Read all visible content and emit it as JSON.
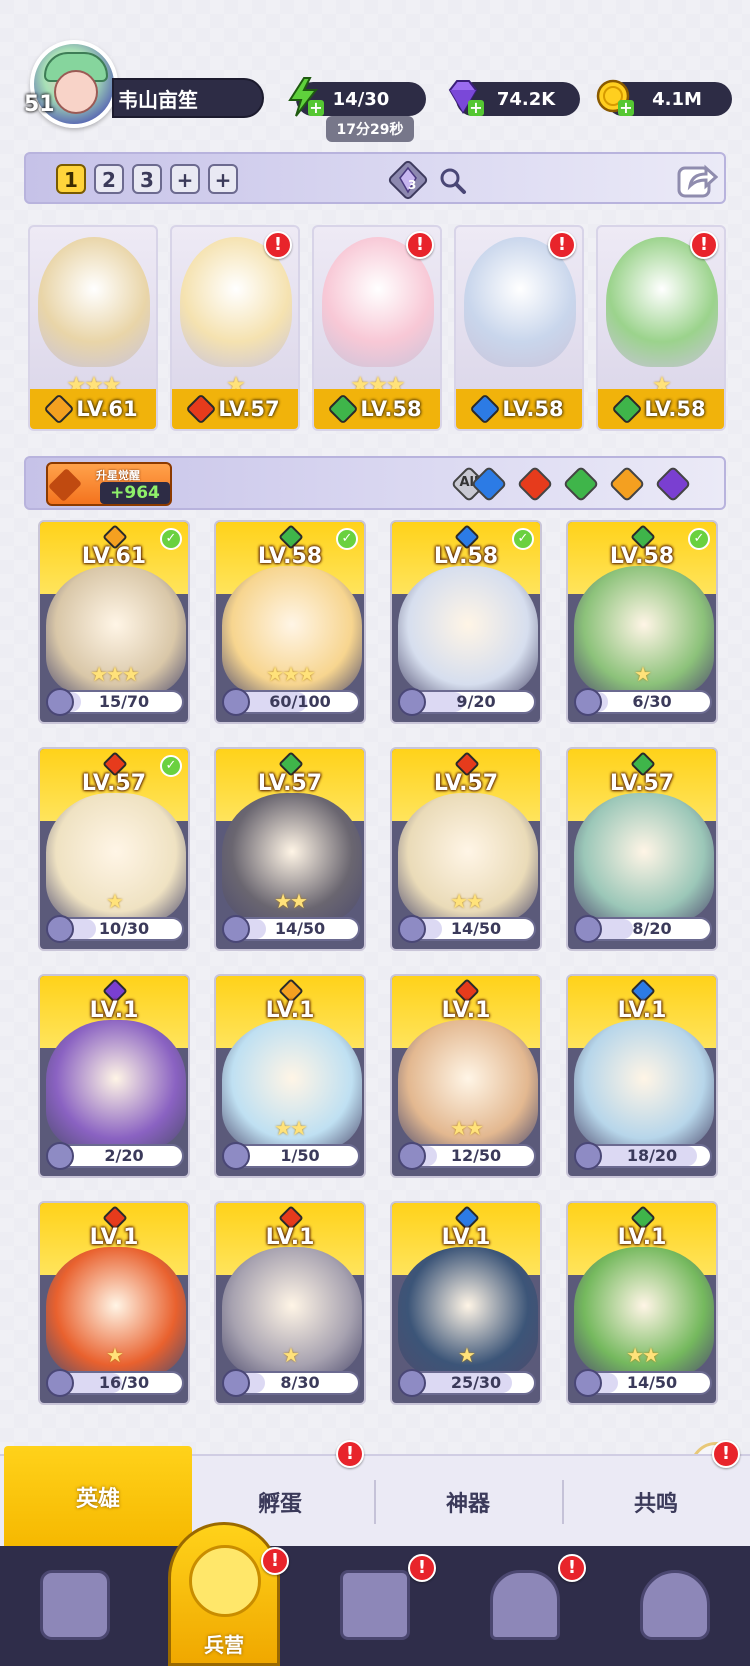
{
  "player": {
    "level": "51",
    "name": "韦山亩笙"
  },
  "resources": {
    "energy": "14/30",
    "energy_timer": "17分29秒",
    "gems": "74.2K",
    "gold": "4.1M",
    "plus_symbol": "+"
  },
  "team": {
    "tabs": [
      "1",
      "2",
      "3",
      "+",
      "+"
    ],
    "active_tab": "1",
    "badge_count": "3"
  },
  "team_heroes": [
    {
      "level": "LV.61",
      "stars": "★★★",
      "element": "light",
      "color": "#f4a020",
      "art": "#e9d5a8",
      "alert": false
    },
    {
      "level": "LV.57",
      "stars": "★",
      "element": "fire",
      "color": "#e63b1c",
      "art": "#f5e2b0",
      "alert": true
    },
    {
      "level": "LV.58",
      "stars": "★★★",
      "element": "nature",
      "color": "#3fb54a",
      "art": "#f8c8d6",
      "alert": true
    },
    {
      "level": "LV.58",
      "stars": "",
      "element": "water",
      "color": "#2c7be5",
      "art": "#c9d6ec",
      "alert": true
    },
    {
      "level": "LV.58",
      "stars": "★",
      "element": "nature",
      "color": "#3fb54a",
      "art": "#9bd38c",
      "alert": true
    }
  ],
  "filter": {
    "awaken_label": "升星觉醒",
    "awaken_count": "+964",
    "all_label": "All",
    "elements": [
      {
        "name": "water",
        "color": "#2c7be5"
      },
      {
        "name": "fire",
        "color": "#e63b1c"
      },
      {
        "name": "nature",
        "color": "#3fb54a"
      },
      {
        "name": "light",
        "color": "#f4a020"
      },
      {
        "name": "dark",
        "color": "#7a3fd1"
      }
    ]
  },
  "heroes": [
    {
      "level": "LV.61",
      "fragments": "15/70",
      "progress": 0.21,
      "element": "light",
      "color": "#f4a020",
      "art": "#d9c7a8",
      "check": true,
      "stars": "★★★"
    },
    {
      "level": "LV.58",
      "fragments": "60/100",
      "progress": 0.6,
      "element": "nature",
      "color": "#3fb54a",
      "art": "#f7d58f",
      "check": true,
      "stars": "★★★"
    },
    {
      "level": "LV.58",
      "fragments": "9/20",
      "progress": 0.45,
      "element": "water",
      "color": "#2c7be5",
      "art": "#d6deee",
      "check": true,
      "stars": ""
    },
    {
      "level": "LV.58",
      "fragments": "6/30",
      "progress": 0.2,
      "element": "nature",
      "color": "#3fb54a",
      "art": "#8cc27a",
      "check": true,
      "stars": "★"
    },
    {
      "level": "LV.57",
      "fragments": "10/30",
      "progress": 0.33,
      "element": "fire",
      "color": "#e63b1c",
      "art": "#efe2c2",
      "check": true,
      "stars": "★"
    },
    {
      "level": "LV.57",
      "fragments": "14/50",
      "progress": 0.28,
      "element": "nature",
      "color": "#3fb54a",
      "art": "#6a6670",
      "check": false,
      "stars": "★★"
    },
    {
      "level": "LV.57",
      "fragments": "14/50",
      "progress": 0.28,
      "element": "fire",
      "color": "#e63b1c",
      "art": "#eadbb8",
      "check": false,
      "stars": "★★"
    },
    {
      "level": "LV.57",
      "fragments": "8/20",
      "progress": 0.4,
      "element": "nature",
      "color": "#3fb54a",
      "art": "#9bc7b8",
      "check": false,
      "stars": ""
    },
    {
      "level": "LV.1",
      "fragments": "2/20",
      "progress": 0.1,
      "element": "dark",
      "color": "#7a3fd1",
      "art": "#8a62c2",
      "check": false,
      "stars": ""
    },
    {
      "level": "LV.1",
      "fragments": "1/50",
      "progress": 0.02,
      "element": "light",
      "color": "#f4a020",
      "art": "#bfe0f2",
      "check": false,
      "stars": "★★"
    },
    {
      "level": "LV.1",
      "fragments": "12/50",
      "progress": 0.24,
      "element": "fire",
      "color": "#e63b1c",
      "art": "#e3b890",
      "check": false,
      "stars": "★★"
    },
    {
      "level": "LV.1",
      "fragments": "18/20",
      "progress": 0.9,
      "element": "water",
      "color": "#2c7be5",
      "art": "#b7d6ea",
      "check": false,
      "stars": ""
    },
    {
      "level": "LV.1",
      "fragments": "16/30",
      "progress": 0.53,
      "element": "fire",
      "color": "#e63b1c",
      "art": "#e9612e",
      "check": false,
      "stars": "★"
    },
    {
      "level": "LV.1",
      "fragments": "8/30",
      "progress": 0.27,
      "element": "fire",
      "color": "#e63b1c",
      "art": "#a7a2b0",
      "check": false,
      "stars": "★"
    },
    {
      "level": "LV.1",
      "fragments": "25/30",
      "progress": 0.83,
      "element": "water",
      "color": "#2c7be5",
      "art": "#3c5578",
      "check": false,
      "stars": "★"
    },
    {
      "level": "LV.1",
      "fragments": "14/50",
      "progress": 0.28,
      "element": "nature",
      "color": "#3fb54a",
      "art": "#75b95e",
      "check": false,
      "stars": "★★"
    }
  ],
  "subtabs": {
    "items": [
      "英雄",
      "孵蛋",
      "神器",
      "共鸣"
    ],
    "active": "英雄"
  },
  "bottom_nav": {
    "active_label": "兵营"
  },
  "alert_symbol": "!",
  "check_symbol": "✓"
}
